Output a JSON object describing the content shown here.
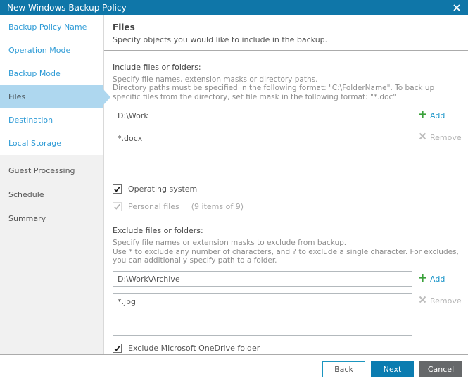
{
  "window": {
    "title": "New Windows Backup Policy"
  },
  "sidebar": {
    "items": [
      {
        "label": "Backup Policy Name",
        "state": "enabled"
      },
      {
        "label": "Operation Mode",
        "state": "enabled"
      },
      {
        "label": "Backup Mode",
        "state": "enabled"
      },
      {
        "label": "Files",
        "state": "selected"
      },
      {
        "label": "Destination",
        "state": "enabled"
      },
      {
        "label": "Local Storage",
        "state": "enabled"
      },
      {
        "label": "Guest Processing",
        "state": "future"
      },
      {
        "label": "Schedule",
        "state": "future"
      },
      {
        "label": "Summary",
        "state": "future"
      }
    ]
  },
  "header": {
    "title": "Files",
    "subtitle": "Specify objects you would like to include in the backup."
  },
  "include": {
    "label": "Include files or folders:",
    "hint_line1": "Specify file names, extension masks or directory paths.",
    "hint_line2": "Directory paths must be specified in the following format: \"C:\\FolderName\". To back up specific files from the directory, set file mask in the following format: \"*.doc\"",
    "input_value": "D:\\Work",
    "add_label": "Add",
    "remove_label": "Remove",
    "list_items": [
      "*.docx"
    ],
    "checkboxes": [
      {
        "label": "Operating system",
        "checked": true,
        "enabled": true
      },
      {
        "label": "Personal files",
        "suffix": "(9 items of 9)",
        "checked": true,
        "enabled": false
      }
    ]
  },
  "exclude": {
    "label": "Exclude files or folders:",
    "hint_line1": "Specify file names or extension masks to exclude from backup.",
    "hint_line2": "Use * to exclude any number of characters, and ? to exclude a single character. For excludes, you can additionally specify path to a folder.",
    "input_value": "D:\\Work\\Archive",
    "add_label": "Add",
    "remove_label": "Remove",
    "list_items": [
      "*.jpg"
    ],
    "checkbox": {
      "label": "Exclude Microsoft OneDrive folder",
      "checked": true
    }
  },
  "footer": {
    "back_label": "Back",
    "next_label": "Next",
    "cancel_label": "Cancel"
  },
  "colors": {
    "titlebar": "#0f76a8",
    "selected_step_bg": "#aed7ef",
    "step_link": "#2e9bd6",
    "add_plus_green": "#3aa13a",
    "add_link_blue": "#1b95c9",
    "next_button": "#0b7cb0",
    "cancel_button": "#66686a",
    "back_border": "#1b95bf"
  },
  "icons": {
    "close": "x-close",
    "add": "green-plus",
    "remove": "gray-x",
    "checked": "black-check"
  }
}
